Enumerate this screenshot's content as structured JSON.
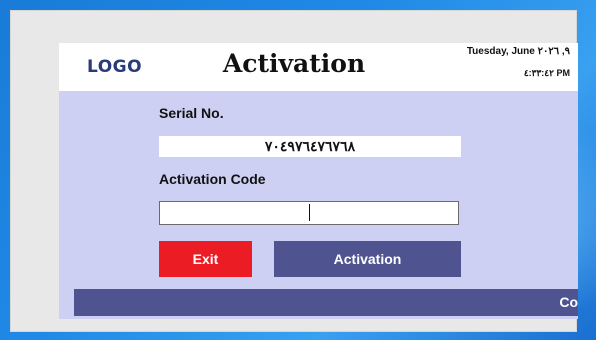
{
  "header": {
    "logo_text": "LOGO",
    "title": "Activation",
    "date": "Tuesday, June ٩, ٢٠٢٦",
    "time": "٤:٣٣:٤٢ PM"
  },
  "form": {
    "serial_label": "Serial No.",
    "serial_value": "٧٠٤٩٧٦٤٧٦٧٦٨",
    "code_label": "Activation Code",
    "code_value": ""
  },
  "buttons": {
    "exit_label": "Exit",
    "activate_label": "Activation"
  },
  "footer": {
    "text": "Co"
  },
  "colors": {
    "window_bg": "#cdd0f2",
    "accent": "#4f5490",
    "exit": "#ec1c24",
    "desktop": "#1f8ae6"
  }
}
